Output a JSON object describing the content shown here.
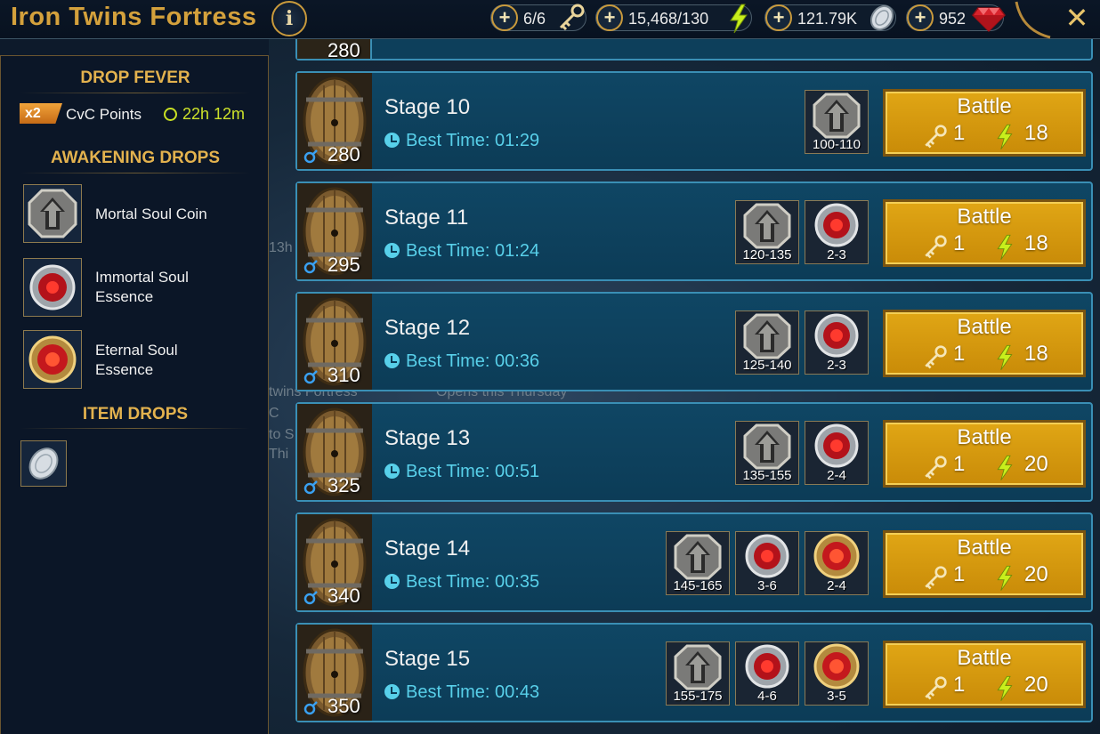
{
  "header": {
    "title": "Iron Twins Fortress",
    "info_label": "i",
    "resources": [
      {
        "name": "keys",
        "value": "6/6"
      },
      {
        "name": "energy",
        "value": "15,468/130"
      },
      {
        "name": "silver",
        "value": "121.79K"
      },
      {
        "name": "gems",
        "value": "952"
      }
    ],
    "plus_label": "+",
    "close_label": "✕"
  },
  "sidebar": {
    "drop_fever": {
      "heading": "DROP FEVER",
      "multiplier": "x2",
      "label": "CvC Points",
      "time": "22h 12m"
    },
    "awakening_heading": "AWAKENING DROPS",
    "awakening_items": [
      {
        "label_line1": "Mortal Soul Coin",
        "label_line2": ""
      },
      {
        "label_line1": "Immortal Soul",
        "label_line2": "Essence"
      },
      {
        "label_line1": "Eternal Soul",
        "label_line2": "Essence"
      }
    ],
    "item_heading": "ITEM DROPS"
  },
  "background": {
    "fragments": [
      "13h",
      "twins Fortress",
      "Opens this Thursday",
      "C",
      "to S",
      "Thi"
    ]
  },
  "clipped_stage": {
    "boss_number": "280"
  },
  "stages": [
    {
      "name": "Stage 10",
      "best_label": "Best Time: 01:29",
      "boss_number": "280",
      "drops": [
        {
          "kind": "mortal-coin",
          "qty": "100-110"
        }
      ],
      "battle_label": "Battle",
      "key_cost": "1",
      "energy_cost": "18"
    },
    {
      "name": "Stage 11",
      "best_label": "Best Time: 01:24",
      "boss_number": "295",
      "drops": [
        {
          "kind": "mortal-coin",
          "qty": "120-135"
        },
        {
          "kind": "immortal-essence",
          "qty": "2-3"
        }
      ],
      "battle_label": "Battle",
      "key_cost": "1",
      "energy_cost": "18"
    },
    {
      "name": "Stage 12",
      "best_label": "Best Time: 00:36",
      "boss_number": "310",
      "drops": [
        {
          "kind": "mortal-coin",
          "qty": "125-140"
        },
        {
          "kind": "immortal-essence",
          "qty": "2-3"
        }
      ],
      "battle_label": "Battle",
      "key_cost": "1",
      "energy_cost": "18"
    },
    {
      "name": "Stage 13",
      "best_label": "Best Time: 00:51",
      "boss_number": "325",
      "drops": [
        {
          "kind": "mortal-coin",
          "qty": "135-155"
        },
        {
          "kind": "immortal-essence",
          "qty": "2-4"
        }
      ],
      "battle_label": "Battle",
      "key_cost": "1",
      "energy_cost": "20"
    },
    {
      "name": "Stage 14",
      "best_label": "Best Time: 00:35",
      "boss_number": "340",
      "drops": [
        {
          "kind": "mortal-coin",
          "qty": "145-165"
        },
        {
          "kind": "immortal-essence",
          "qty": "3-6"
        },
        {
          "kind": "eternal-essence",
          "qty": "2-4"
        }
      ],
      "battle_label": "Battle",
      "key_cost": "1",
      "energy_cost": "20"
    },
    {
      "name": "Stage 15",
      "best_label": "Best Time: 00:43",
      "boss_number": "350",
      "drops": [
        {
          "kind": "mortal-coin",
          "qty": "155-175"
        },
        {
          "kind": "immortal-essence",
          "qty": "4-6"
        },
        {
          "kind": "eternal-essence",
          "qty": "3-5"
        }
      ],
      "battle_label": "Battle",
      "key_cost": "1",
      "energy_cost": "20"
    }
  ],
  "colors": {
    "title_gold": "#d4a13c",
    "section_gold": "#e3b24e",
    "best_time_cyan": "#58d0ea",
    "fever_green": "#cde22a",
    "battle_gold": "#e0a615",
    "card_blue": "#0f4664",
    "card_border": "#3a8fb5"
  }
}
